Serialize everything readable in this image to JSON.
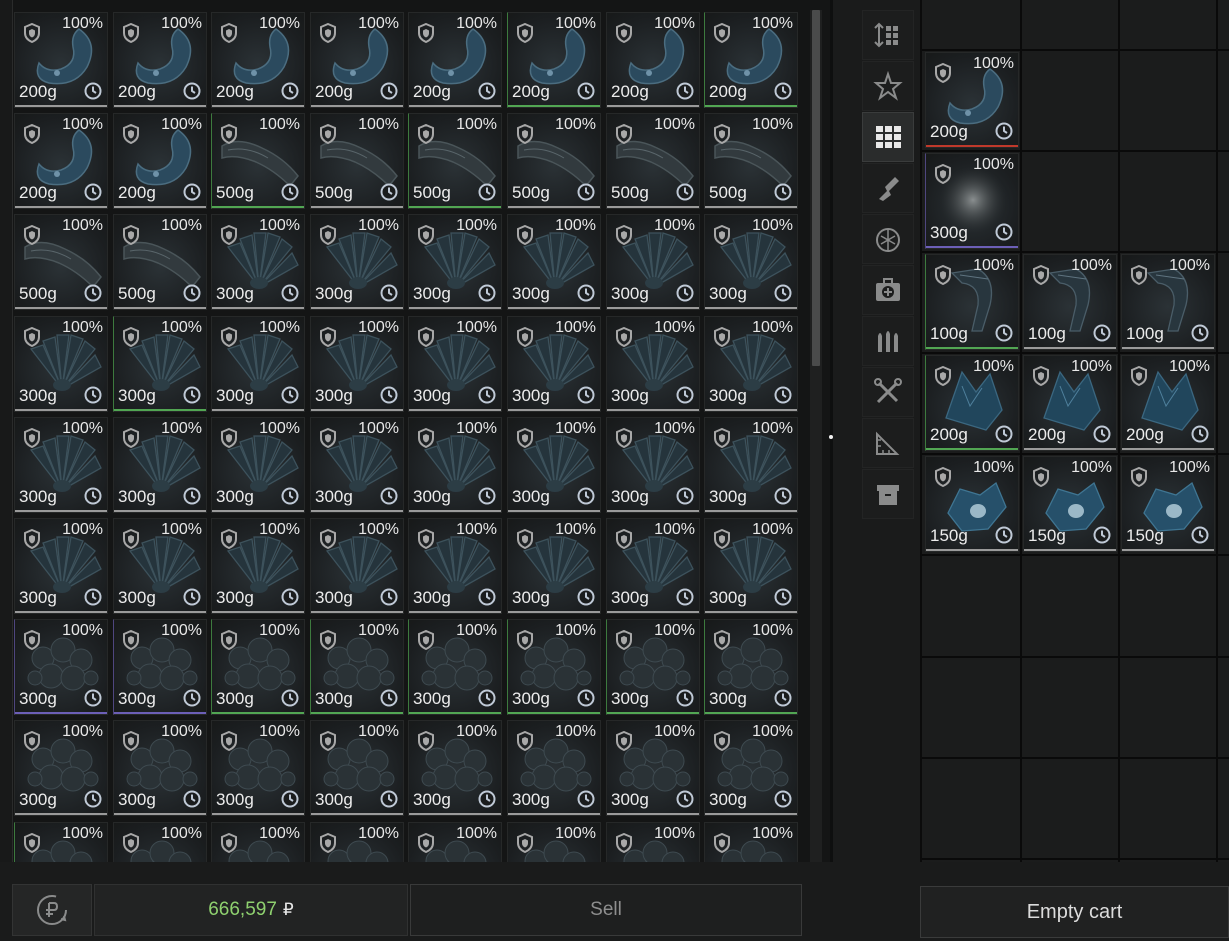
{
  "inventory": {
    "rows": [
      [
        {
          "t": "hook",
          "w": "200g",
          "p": "100%",
          "l": "n"
        },
        {
          "t": "hook",
          "w": "200g",
          "p": "100%",
          "l": "n"
        },
        {
          "t": "hook",
          "w": "200g",
          "p": "100%",
          "l": "n"
        },
        {
          "t": "hook",
          "w": "200g",
          "p": "100%",
          "l": "n"
        },
        {
          "t": "hook",
          "w": "200g",
          "p": "100%",
          "l": "n"
        },
        {
          "t": "hook",
          "w": "200g",
          "p": "100%",
          "l": "green"
        },
        {
          "t": "hook",
          "w": "200g",
          "p": "100%",
          "l": "n"
        },
        {
          "t": "hook",
          "w": "200g",
          "p": "100%",
          "l": "green"
        }
      ],
      [
        {
          "t": "hook",
          "w": "200g",
          "p": "100%",
          "l": "n"
        },
        {
          "t": "hook",
          "w": "200g",
          "p": "100%",
          "l": "n"
        },
        {
          "t": "tube",
          "w": "500g",
          "p": "100%",
          "l": "green"
        },
        {
          "t": "tube",
          "w": "500g",
          "p": "100%",
          "l": "n"
        },
        {
          "t": "tube",
          "w": "500g",
          "p": "100%",
          "l": "green"
        },
        {
          "t": "tube",
          "w": "500g",
          "p": "100%",
          "l": "n"
        },
        {
          "t": "tube",
          "w": "500g",
          "p": "100%",
          "l": "n"
        },
        {
          "t": "tube",
          "w": "500g",
          "p": "100%",
          "l": "n"
        }
      ],
      [
        {
          "t": "tube",
          "w": "500g",
          "p": "100%",
          "l": "n"
        },
        {
          "t": "tube",
          "w": "500g",
          "p": "100%",
          "l": "n"
        },
        {
          "t": "fan",
          "w": "300g",
          "p": "100%",
          "l": "n"
        },
        {
          "t": "fan",
          "w": "300g",
          "p": "100%",
          "l": "n"
        },
        {
          "t": "fan",
          "w": "300g",
          "p": "100%",
          "l": "n"
        },
        {
          "t": "fan",
          "w": "300g",
          "p": "100%",
          "l": "n"
        },
        {
          "t": "fan",
          "w": "300g",
          "p": "100%",
          "l": "n"
        },
        {
          "t": "fan",
          "w": "300g",
          "p": "100%",
          "l": "n"
        }
      ],
      [
        {
          "t": "fan",
          "w": "300g",
          "p": "100%",
          "l": "n"
        },
        {
          "t": "fan",
          "w": "300g",
          "p": "100%",
          "l": "green"
        },
        {
          "t": "fan",
          "w": "300g",
          "p": "100%",
          "l": "n"
        },
        {
          "t": "fan",
          "w": "300g",
          "p": "100%",
          "l": "n"
        },
        {
          "t": "fan",
          "w": "300g",
          "p": "100%",
          "l": "n"
        },
        {
          "t": "fan",
          "w": "300g",
          "p": "100%",
          "l": "n"
        },
        {
          "t": "fan",
          "w": "300g",
          "p": "100%",
          "l": "n"
        },
        {
          "t": "fan",
          "w": "300g",
          "p": "100%",
          "l": "n"
        }
      ],
      [
        {
          "t": "fan",
          "w": "300g",
          "p": "100%",
          "l": "n"
        },
        {
          "t": "fan",
          "w": "300g",
          "p": "100%",
          "l": "n"
        },
        {
          "t": "fan",
          "w": "300g",
          "p": "100%",
          "l": "n"
        },
        {
          "t": "fan",
          "w": "300g",
          "p": "100%",
          "l": "n"
        },
        {
          "t": "fan",
          "w": "300g",
          "p": "100%",
          "l": "n"
        },
        {
          "t": "fan",
          "w": "300g",
          "p": "100%",
          "l": "n"
        },
        {
          "t": "fan",
          "w": "300g",
          "p": "100%",
          "l": "n"
        },
        {
          "t": "fan",
          "w": "300g",
          "p": "100%",
          "l": "n"
        }
      ],
      [
        {
          "t": "fan",
          "w": "300g",
          "p": "100%",
          "l": "n"
        },
        {
          "t": "fan",
          "w": "300g",
          "p": "100%",
          "l": "n"
        },
        {
          "t": "fan",
          "w": "300g",
          "p": "100%",
          "l": "n"
        },
        {
          "t": "fan",
          "w": "300g",
          "p": "100%",
          "l": "n"
        },
        {
          "t": "fan",
          "w": "300g",
          "p": "100%",
          "l": "n"
        },
        {
          "t": "fan",
          "w": "300g",
          "p": "100%",
          "l": "n"
        },
        {
          "t": "fan",
          "w": "300g",
          "p": "100%",
          "l": "n"
        },
        {
          "t": "fan",
          "w": "300g",
          "p": "100%",
          "l": "n"
        }
      ],
      [
        {
          "t": "lump",
          "w": "300g",
          "p": "100%",
          "l": "purple"
        },
        {
          "t": "lump",
          "w": "300g",
          "p": "100%",
          "l": "purple"
        },
        {
          "t": "lump",
          "w": "300g",
          "p": "100%",
          "l": "green"
        },
        {
          "t": "lump",
          "w": "300g",
          "p": "100%",
          "l": "green"
        },
        {
          "t": "lump",
          "w": "300g",
          "p": "100%",
          "l": "green"
        },
        {
          "t": "lump",
          "w": "300g",
          "p": "100%",
          "l": "green"
        },
        {
          "t": "lump",
          "w": "300g",
          "p": "100%",
          "l": "green"
        },
        {
          "t": "lump",
          "w": "300g",
          "p": "100%",
          "l": "green"
        }
      ],
      [
        {
          "t": "lump",
          "w": "300g",
          "p": "100%",
          "l": "n"
        },
        {
          "t": "lump",
          "w": "300g",
          "p": "100%",
          "l": "n"
        },
        {
          "t": "lump",
          "w": "300g",
          "p": "100%",
          "l": "n"
        },
        {
          "t": "lump",
          "w": "300g",
          "p": "100%",
          "l": "n"
        },
        {
          "t": "lump",
          "w": "300g",
          "p": "100%",
          "l": "n"
        },
        {
          "t": "lump",
          "w": "300g",
          "p": "100%",
          "l": "n"
        },
        {
          "t": "lump",
          "w": "300g",
          "p": "100%",
          "l": "n"
        },
        {
          "t": "lump",
          "w": "300g",
          "p": "100%",
          "l": "n"
        }
      ],
      [
        {
          "t": "lump",
          "w": "",
          "p": "100%",
          "l": "green"
        },
        {
          "t": "lump",
          "w": "",
          "p": "100%",
          "l": "n"
        },
        {
          "t": "lump",
          "w": "",
          "p": "100%",
          "l": "n"
        },
        {
          "t": "lump",
          "w": "",
          "p": "100%",
          "l": "n"
        },
        {
          "t": "lump",
          "w": "",
          "p": "100%",
          "l": "n"
        },
        {
          "t": "lump",
          "w": "",
          "p": "100%",
          "l": "n"
        },
        {
          "t": "lump",
          "w": "",
          "p": "100%",
          "l": "n"
        },
        {
          "t": "lump",
          "w": "",
          "p": "100%",
          "l": "n"
        }
      ]
    ]
  },
  "sidebar": {
    "buttons": [
      {
        "name": "sort-icon",
        "active": false
      },
      {
        "name": "favorite-star-icon",
        "active": false
      },
      {
        "name": "grid-view-icon",
        "active": true
      },
      {
        "name": "weapon-mods-icon",
        "active": false
      },
      {
        "name": "grenade-icon",
        "active": false
      },
      {
        "name": "medkit-icon",
        "active": false
      },
      {
        "name": "ammo-icon",
        "active": false
      },
      {
        "name": "tools-icon",
        "active": false
      },
      {
        "name": "ruler-icon",
        "active": false
      },
      {
        "name": "storage-box-icon",
        "active": false
      }
    ]
  },
  "cart": {
    "items": [
      {
        "col": 0,
        "row": 0,
        "t": "hook",
        "w": "200g",
        "p": "100%",
        "l": "red"
      },
      {
        "col": 0,
        "row": 1,
        "t": "blob",
        "w": "300g",
        "p": "100%",
        "l": "purple"
      },
      {
        "col": 0,
        "row": 2,
        "t": "claw",
        "w": "100g",
        "p": "100%",
        "l": "green"
      },
      {
        "col": 1,
        "row": 2,
        "t": "claw",
        "w": "100g",
        "p": "100%",
        "l": "n"
      },
      {
        "col": 2,
        "row": 2,
        "t": "claw",
        "w": "100g",
        "p": "100%",
        "l": "n"
      },
      {
        "col": 0,
        "row": 3,
        "t": "shard",
        "w": "200g",
        "p": "100%",
        "l": "green"
      },
      {
        "col": 1,
        "row": 3,
        "t": "shard",
        "w": "200g",
        "p": "100%",
        "l": "n"
      },
      {
        "col": 2,
        "row": 3,
        "t": "shard",
        "w": "200g",
        "p": "100%",
        "l": "n"
      },
      {
        "col": 0,
        "row": 4,
        "t": "crystal",
        "w": "150g",
        "p": "100%",
        "l": "n"
      },
      {
        "col": 1,
        "row": 4,
        "t": "crystal",
        "w": "150g",
        "p": "100%",
        "l": "n"
      },
      {
        "col": 2,
        "row": 4,
        "t": "crystal",
        "w": "150g",
        "p": "100%",
        "l": "n"
      }
    ]
  },
  "footer": {
    "balance": "666,597",
    "currency": "₽",
    "sell_label": "Sell",
    "empty_cart_label": "Empty cart"
  },
  "colors": {
    "balance": "#8fd16f",
    "legendary_red": "#c0392b",
    "rare_purple": "#6c5fb7",
    "uncommon_green": "#52a653",
    "common_gray": "#9a9a9a"
  }
}
